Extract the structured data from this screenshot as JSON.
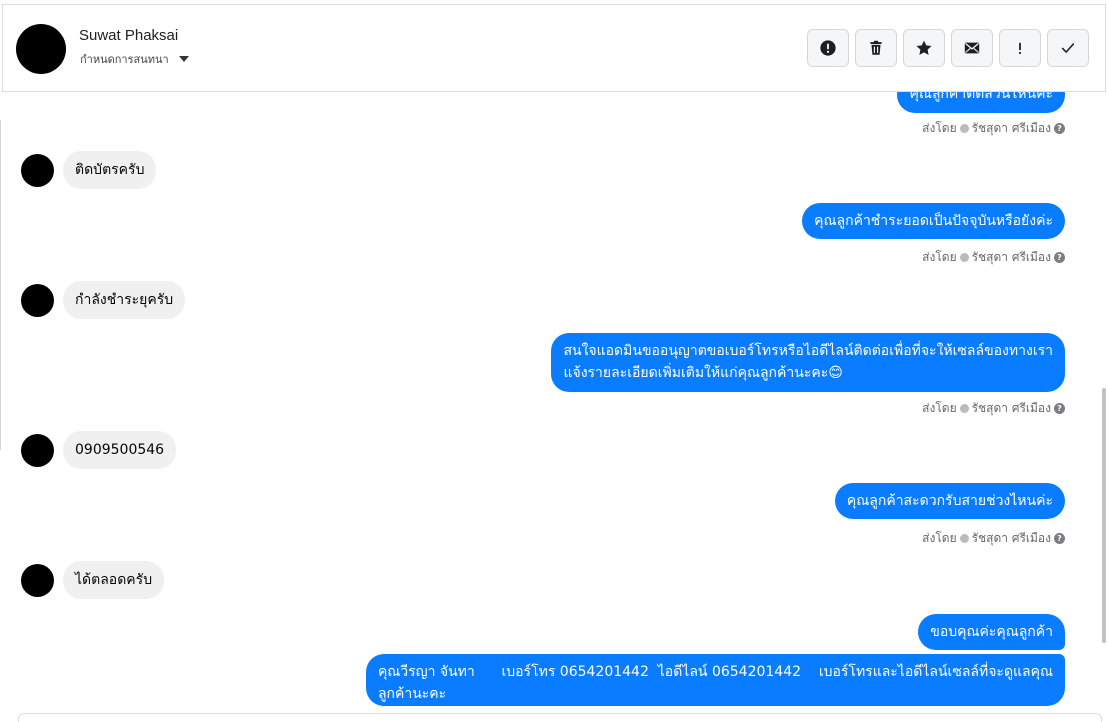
{
  "header": {
    "contact_name": "Suwat Phaksai",
    "assign_label": "กำหนดการสนทนา",
    "actions": [
      {
        "name": "mark-spam-button",
        "icon": "alert-circle-icon"
      },
      {
        "name": "delete-button",
        "icon": "trash-icon"
      },
      {
        "name": "star-button",
        "icon": "star-icon"
      },
      {
        "name": "mark-unread-button",
        "icon": "envelope-icon"
      },
      {
        "name": "follow-up-button",
        "icon": "exclamation-icon"
      },
      {
        "name": "mark-done-button",
        "icon": "checkmark-icon"
      }
    ]
  },
  "messages": {
    "m0": {
      "text": "คุณลูกค้าติดส่วนไหนคะ",
      "sender_prefix": "ส่งโดย",
      "sender_name": "รัชสุดา ศรีเมือง"
    },
    "m1": {
      "text": "ติดบัตรครับ"
    },
    "m2": {
      "text": "คุณลูกค้าชำระยอดเป็นปัจจุบันหรือยังค่ะ",
      "sender_prefix": "ส่งโดย",
      "sender_name": "รัชสุดา ศรีเมือง"
    },
    "m3": {
      "text": "กำลังชำระยุครับ"
    },
    "m4": {
      "line1": "สนใจแอดมินขออนุญาตขอเบอร์โทรหรือไอดีไลน์ติดต่อเพื่อที่จะให้เซลล์ของทางเรา",
      "line2": "แจ้งรายละเอียดเพิ่มเติมให้แก่คุณลูกค้านะคะ😊",
      "sender_prefix": "ส่งโดย",
      "sender_name": "รัชสุดา ศรีเมือง"
    },
    "m5": {
      "text": "0909500546"
    },
    "m6": {
      "text": "คุณลูกค้าสะดวกรับสายช่วงไหนค่ะ",
      "sender_prefix": "ส่งโดย",
      "sender_name": "รัชสุดา ศรีเมือง"
    },
    "m7": {
      "text": "ได้ตลอดครับ"
    },
    "m8": {
      "text": "ขอบคุณค่ะคุณลูกค้า"
    },
    "m9": {
      "line1": "คุณวีรญา จันทา      เบอร์โทร 0654201442  ไอดีไลน์ 0654201442    เบอร์โทรและไอดีไลน์เซลล์ที่จะดูแลคุณ",
      "line2": "ลูกค้านะคะ"
    }
  }
}
